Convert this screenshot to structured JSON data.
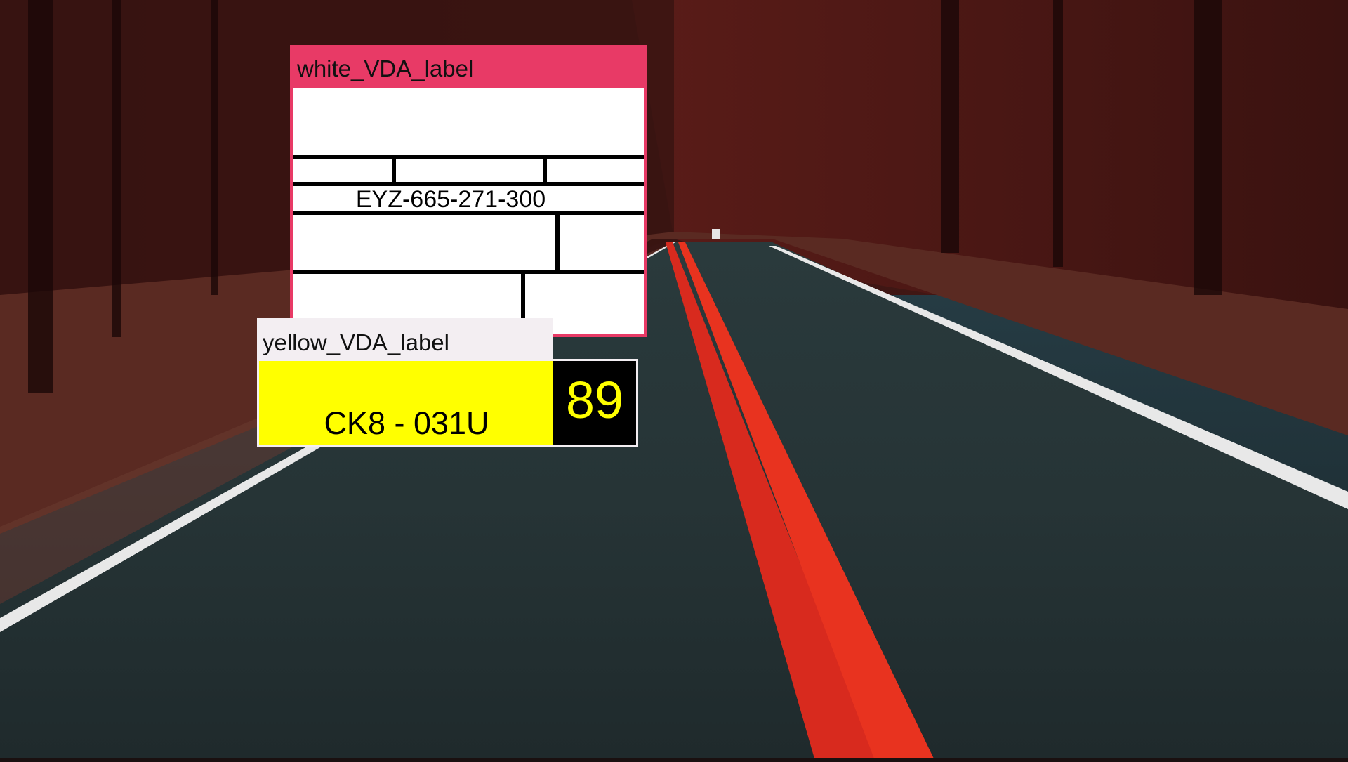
{
  "labels": {
    "white": {
      "caption": "white_VDA_label",
      "serial": "EYZ-665-271-300"
    },
    "yellow": {
      "caption": "yellow_VDA_label",
      "code": "CK8 - 031U",
      "number": "89"
    }
  },
  "colors": {
    "white_box_border": "#e83a66",
    "yellow_label_bg": "#ffff00",
    "yellow_number_text": "#ffff00"
  }
}
